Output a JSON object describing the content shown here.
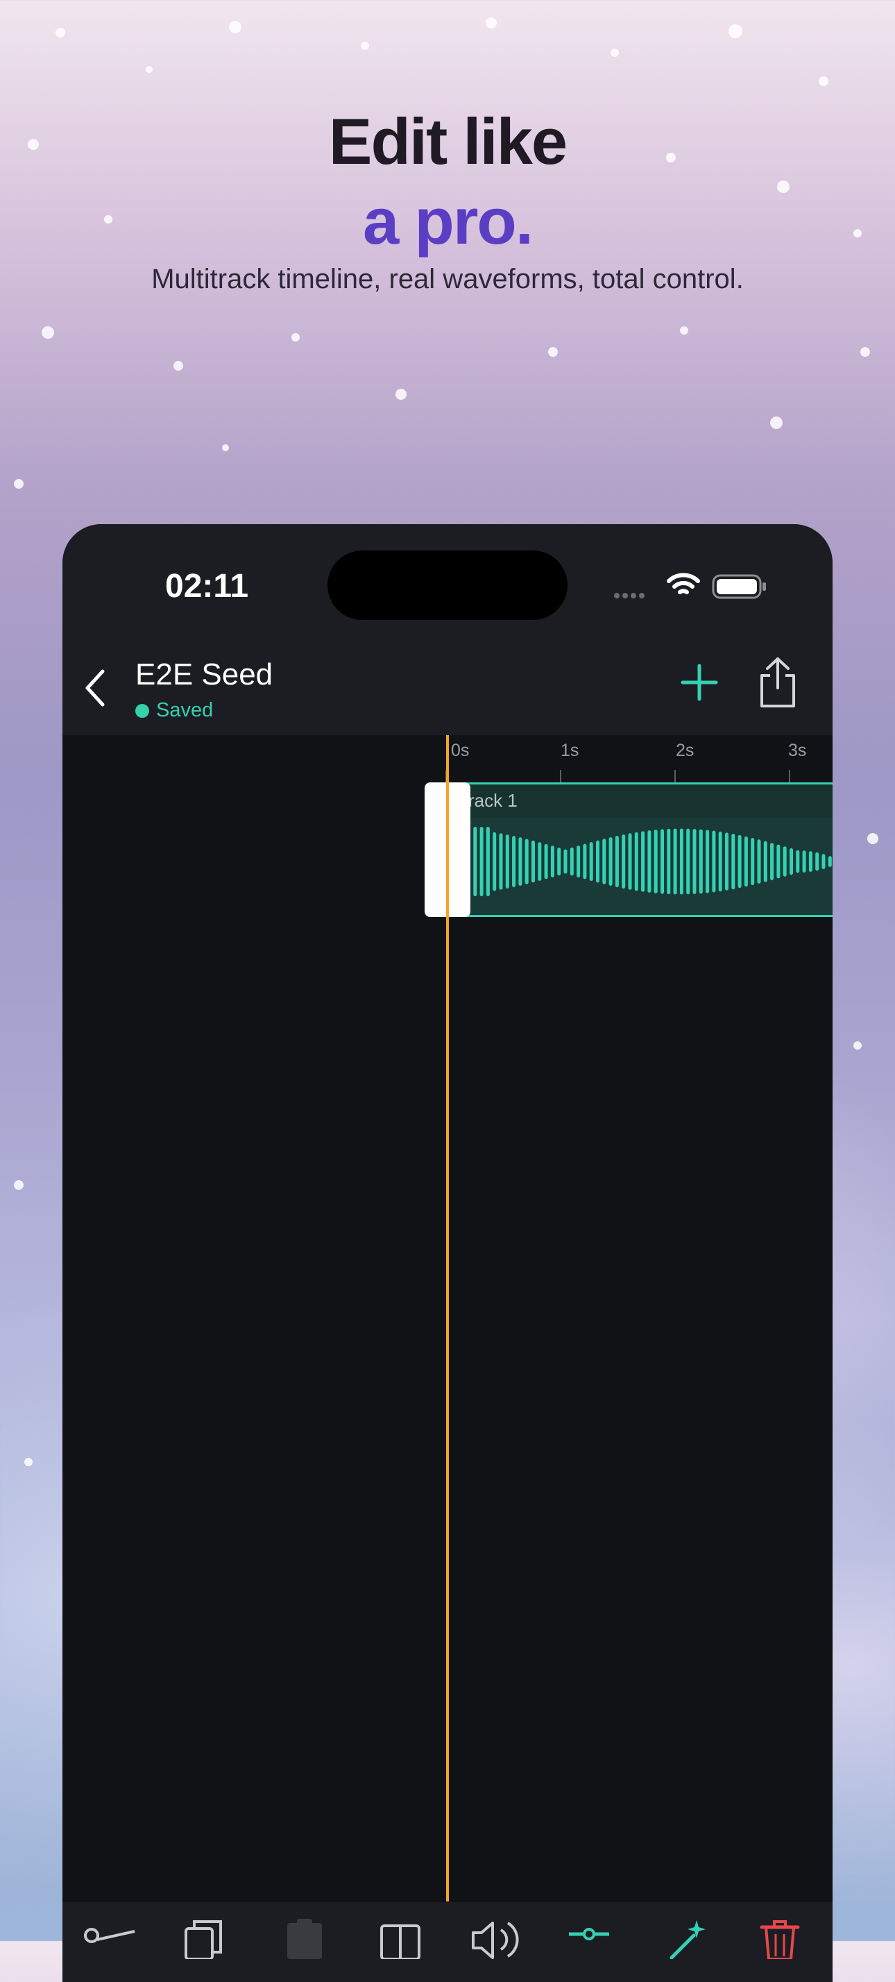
{
  "hero": {
    "line1": "Edit like",
    "line2": "a pro.",
    "subtitle": "Multitrack timeline, real waveforms, total control."
  },
  "status_bar": {
    "time": "02:11"
  },
  "nav": {
    "project_title": "E2E Seed",
    "save_status": "Saved"
  },
  "ruler": {
    "ticks": [
      "0s",
      "1s",
      "2s",
      "3s"
    ]
  },
  "tracks": [
    {
      "label": "Track 1",
      "visible_label": "rack 1"
    }
  ],
  "toolbar": {
    "tools": [
      "cut-icon",
      "copy-icon",
      "paste-icon",
      "split-icon",
      "volume-icon",
      "adjust-icon",
      "effects-icon",
      "delete-icon"
    ]
  },
  "colors": {
    "accent": "#34d1b4",
    "saved": "#35d1a8",
    "playhead": "#f5a523",
    "hero_accent": "#5a3fc5",
    "delete": "#e5484d"
  }
}
